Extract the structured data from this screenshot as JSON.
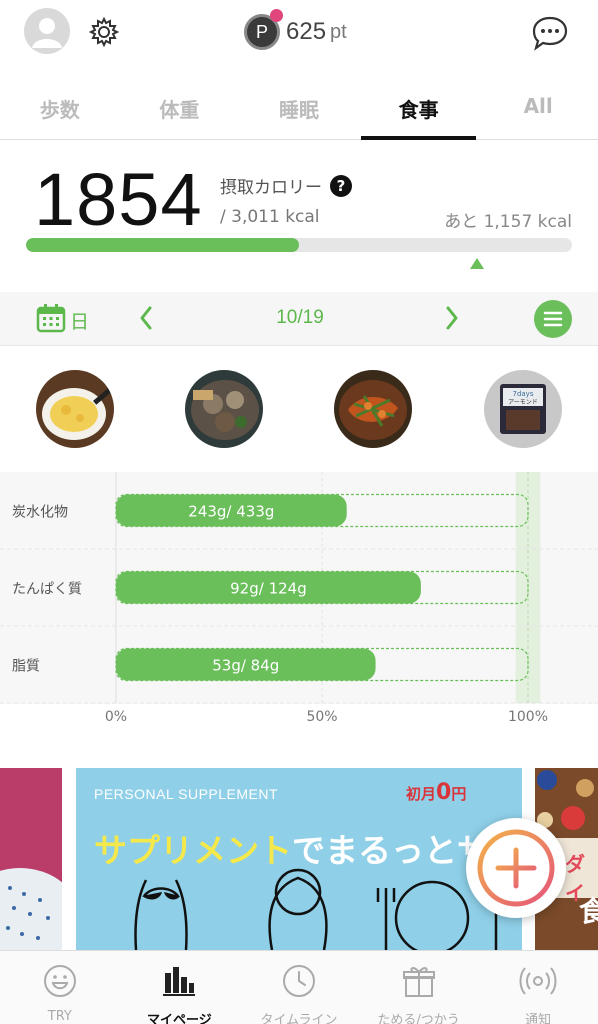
{
  "header": {
    "points_badge": "P",
    "points_value": "625",
    "points_unit": "pt"
  },
  "tabs": [
    {
      "label": "歩数"
    },
    {
      "label": "体重"
    },
    {
      "label": "睡眠"
    },
    {
      "label": "食事",
      "active": true
    },
    {
      "label": "All"
    }
  ],
  "calorie": {
    "intake": "1854",
    "label": "摂取カロリー",
    "help_icon": "?",
    "goal_text": "/ 3,011 kcal",
    "remaining_text": "あと 1,157 kcal",
    "progress": 0.5
  },
  "date_nav": {
    "unit": "日",
    "date": "10/19"
  },
  "meals": [
    {
      "name": "meal-photo-1"
    },
    {
      "name": "meal-photo-2"
    },
    {
      "name": "meal-photo-3"
    },
    {
      "name": "meal-photo-4",
      "label": "7days アーモンド"
    }
  ],
  "chart_data": {
    "type": "bar",
    "orientation": "horizontal",
    "categories": [
      "炭水化物",
      "たんぱく質",
      "脂質"
    ],
    "series": [
      {
        "values": [
          243,
          92,
          53
        ],
        "labels": [
          "243g/ 433g",
          "92g/ 124g",
          "53g/ 84g"
        ]
      }
    ],
    "targets": [
      433,
      124,
      84
    ],
    "percent_of_target": [
      56,
      74,
      63
    ],
    "xticks": [
      "0%",
      "50%",
      "100%"
    ],
    "xlim": [
      0,
      100
    ],
    "colors": {
      "bar": "#6abf5a",
      "target_outline": "#6abf5a"
    }
  },
  "banner": {
    "en_text": "PERSONAL SUPPLEMENT",
    "badge_pre": "初月",
    "badge_num": "0",
    "badge_post": "円",
    "title_a": "サプリメント",
    "title_b": "でまるっとサポー",
    "right_text": "ダイ",
    "right_text2": "食"
  },
  "fab": {
    "icon": "plus-icon"
  },
  "bottom_nav": [
    {
      "label": "TRY",
      "icon": "smile-icon"
    },
    {
      "label": "マイページ",
      "icon": "bar-chart-icon",
      "active": true
    },
    {
      "label": "タイムライン",
      "icon": "clock-icon"
    },
    {
      "label": "ためる/つかう",
      "icon": "gift-icon"
    },
    {
      "label": "通知",
      "icon": "notification-icon"
    }
  ]
}
